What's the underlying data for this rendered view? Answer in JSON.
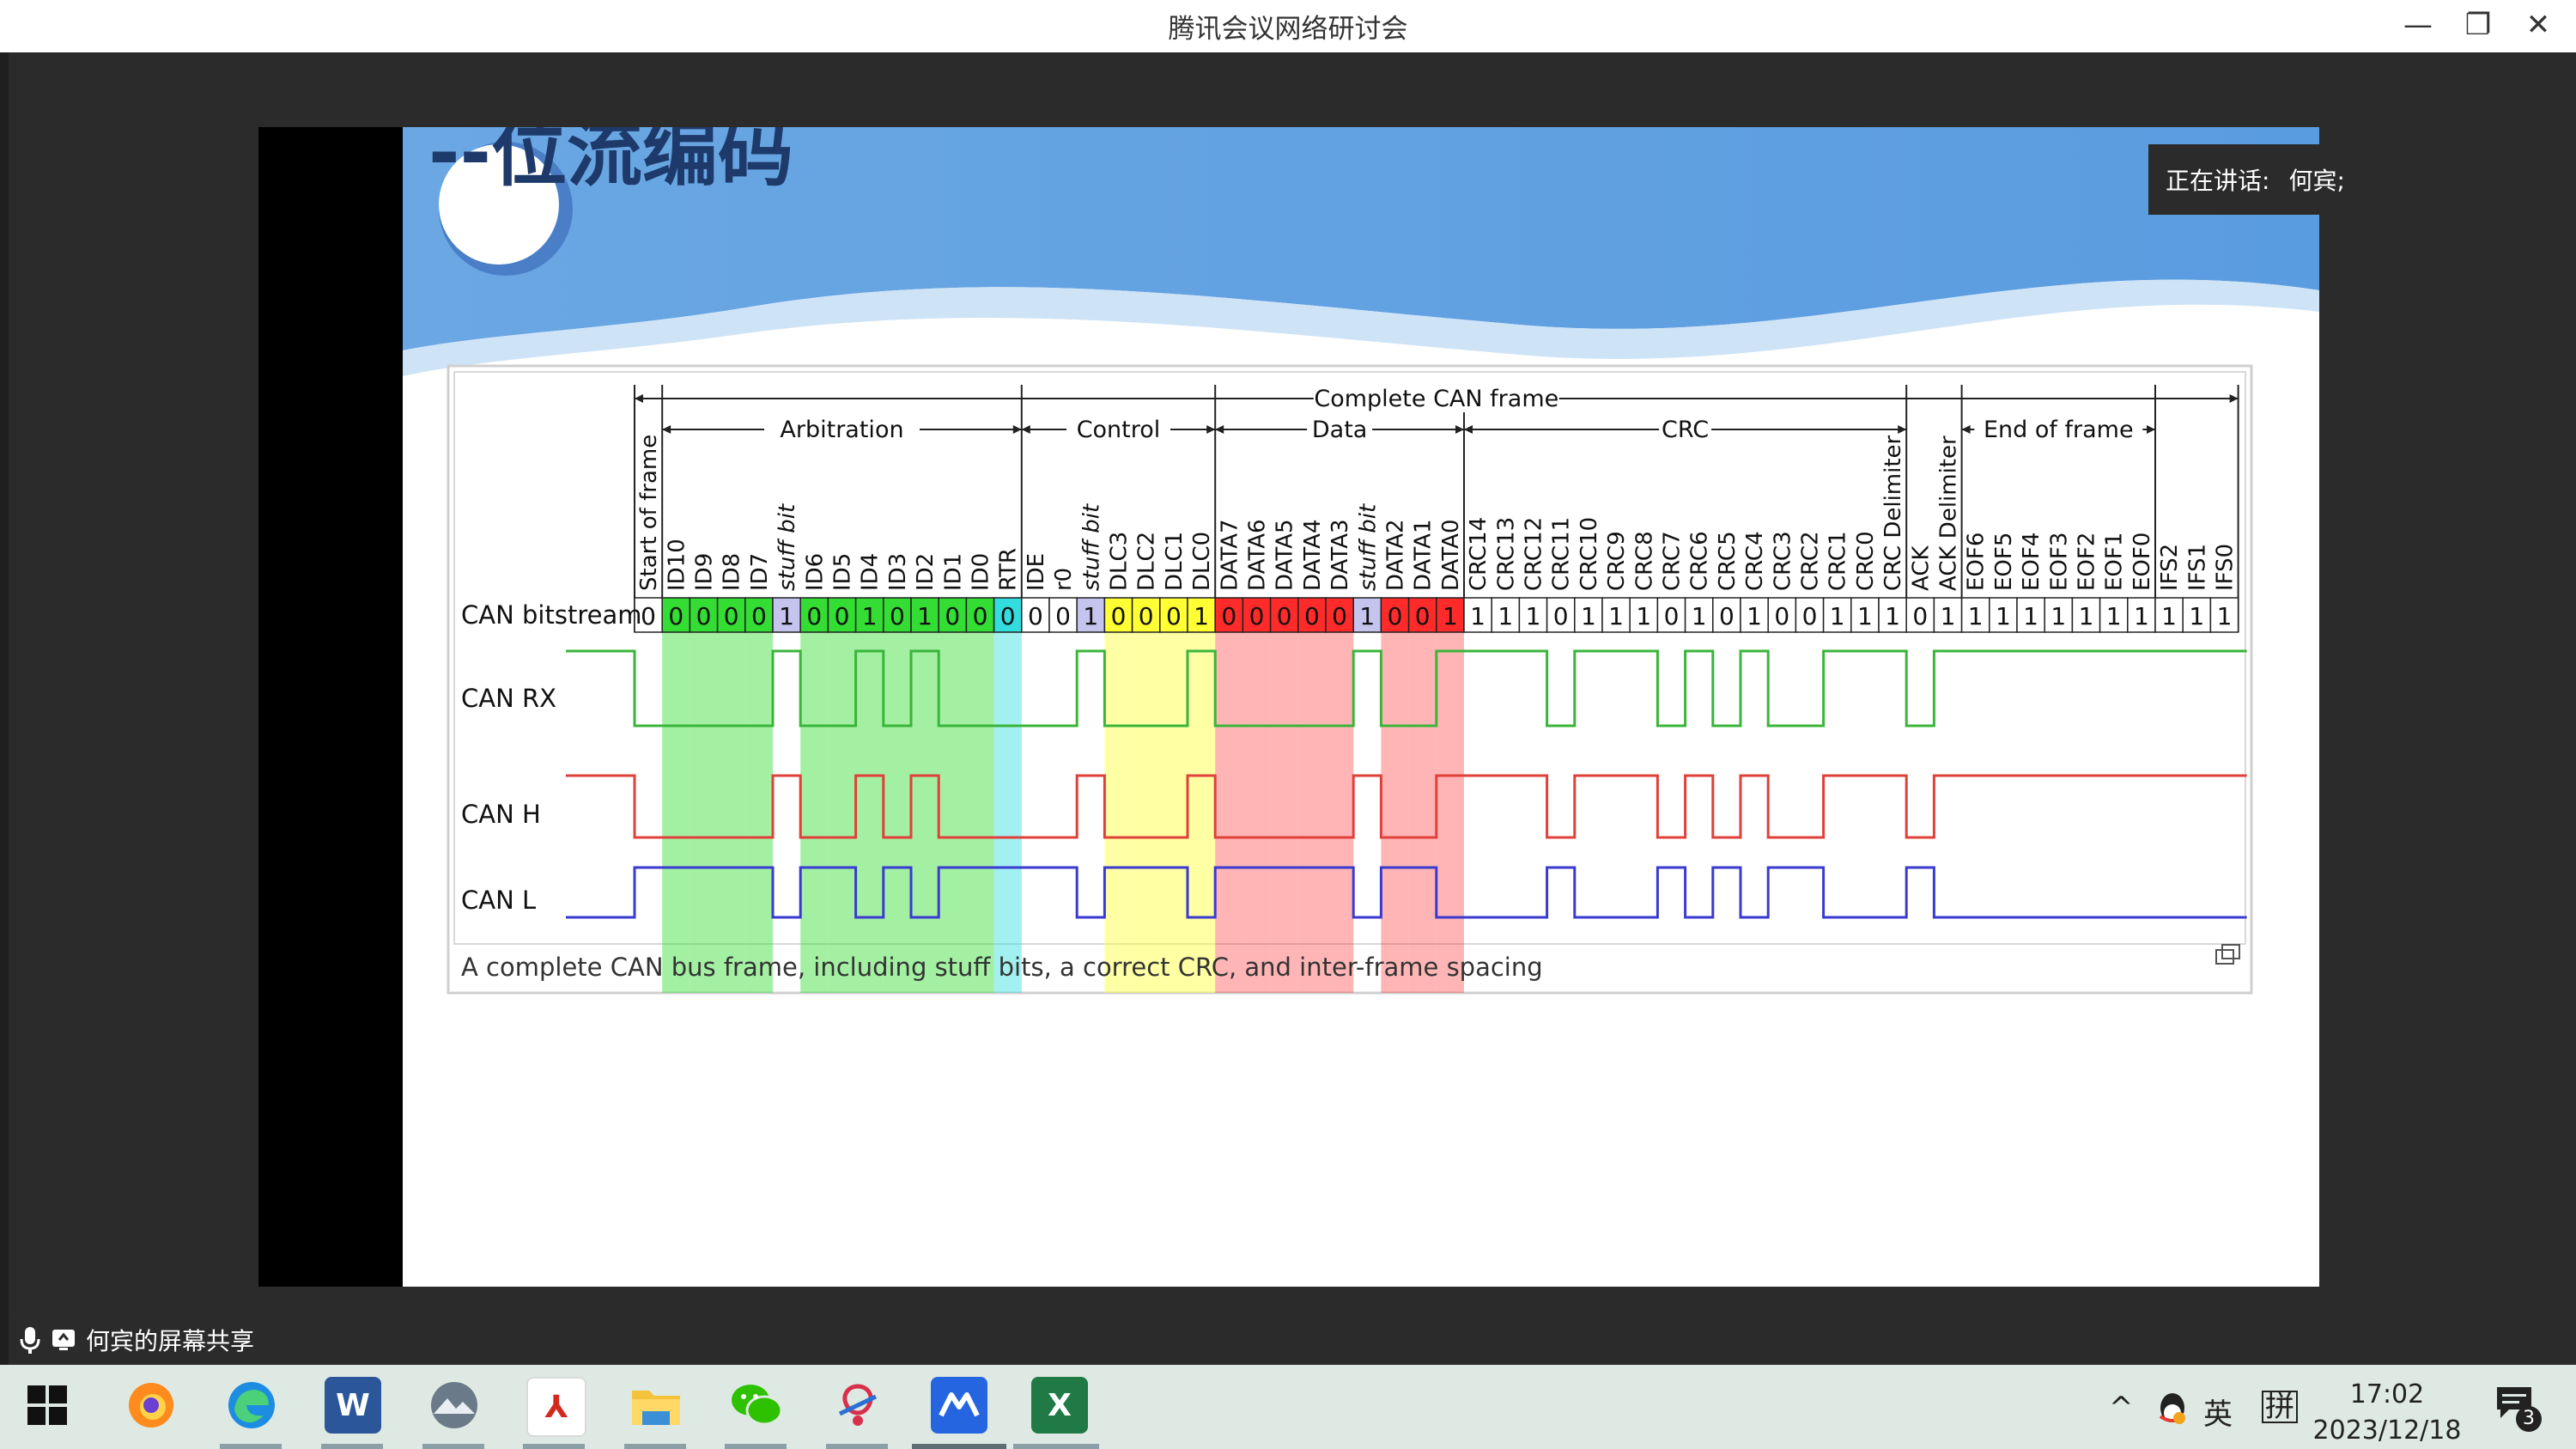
{
  "window": {
    "title": "腾讯会议网络研讨会"
  },
  "speaker": {
    "label": "正在讲话:",
    "name": "何宾;"
  },
  "share": {
    "label": "何宾的屏幕共享"
  },
  "slide": {
    "title": "--位流编码",
    "caption": "A complete CAN bus frame, including stuff bits, a correct CRC, and inter-frame spacing",
    "groups": {
      "complete": "Complete CAN frame",
      "arbitration": "Arbitration",
      "control": "Control",
      "data": "Data",
      "crc": "CRC",
      "eof": "End of frame"
    },
    "row_labels": {
      "bitstream": "CAN bitstream",
      "rx": "CAN RX",
      "h": "CAN H",
      "l": "CAN L"
    },
    "fields": [
      "Start of frame",
      "ID10",
      "ID9",
      "ID8",
      "ID7",
      "stuff bit",
      "ID6",
      "ID5",
      "ID4",
      "ID3",
      "ID2",
      "ID1",
      "ID0",
      "RTR",
      "IDE",
      "r0",
      "stuff bit",
      "DLC3",
      "DLC2",
      "DLC1",
      "DLC0",
      "DATA7",
      "DATA6",
      "DATA5",
      "DATA4",
      "DATA3",
      "stuff bit",
      "DATA2",
      "DATA1",
      "DATA0",
      "CRC14",
      "CRC13",
      "CRC12",
      "CRC11",
      "CRC10",
      "CRC9",
      "CRC8",
      "CRC7",
      "CRC6",
      "CRC5",
      "CRC4",
      "CRC3",
      "CRC2",
      "CRC1",
      "CRC0",
      "CRC Delimiter",
      "ACK",
      "ACK Delimiter",
      "EOF6",
      "EOF5",
      "EOF4",
      "EOF3",
      "EOF2",
      "EOF1",
      "EOF0",
      "IFS2",
      "IFS1",
      "IFS0"
    ],
    "bits": [
      "0",
      "0",
      "0",
      "0",
      "0",
      "1",
      "0",
      "0",
      "1",
      "0",
      "1",
      "0",
      "0",
      "0",
      "0",
      "0",
      "1",
      "0",
      "0",
      "0",
      "1",
      "0",
      "0",
      "0",
      "0",
      "0",
      "1",
      "0",
      "0",
      "1",
      "1",
      "1",
      "1",
      "0",
      "1",
      "1",
      "1",
      "0",
      "1",
      "0",
      "1",
      "0",
      "0",
      "1",
      "1",
      "1",
      "0",
      "1",
      "1",
      "1",
      "1",
      "1",
      "1",
      "1",
      "1",
      "1",
      "1",
      "1"
    ],
    "categories": [
      "sof",
      "arb",
      "arb",
      "arb",
      "arb",
      "stuff",
      "arb",
      "arb",
      "arb",
      "arb",
      "arb",
      "arb",
      "arb",
      "rtr",
      "ctrl",
      "ctrl",
      "stuff",
      "dlc",
      "dlc",
      "dlc",
      "dlc",
      "data",
      "data",
      "data",
      "data",
      "data",
      "stuff",
      "data",
      "data",
      "data",
      "crc",
      "crc",
      "crc",
      "crc",
      "crc",
      "crc",
      "crc",
      "crc",
      "crc",
      "crc",
      "crc",
      "crc",
      "crc",
      "crc",
      "crc",
      "crc",
      "crc",
      "crc",
      "crc",
      "crc",
      "crc",
      "crc",
      "crc",
      "crc",
      "crc",
      "crc",
      "crc",
      "crc"
    ]
  },
  "colors": {
    "arb": "#33dd33",
    "stuff": "#c4c4ee",
    "rtr": "#33dddd",
    "dlc": "#ffff33",
    "data": "#ff2a2a",
    "rx": "#3ab53a",
    "h": "#e0403a",
    "l": "#3a3ad0"
  },
  "taskbar": {
    "icons": [
      "windows-start-icon",
      "firefox-icon",
      "edge-icon",
      "word-icon",
      "photo-viewer-icon",
      "acrobat-icon",
      "file-explorer-icon",
      "wechat-icon",
      "xmind-icon",
      "tencent-meeting-icon",
      "excel-icon"
    ],
    "ime1": "英",
    "ime2": "拼",
    "time": "17:02",
    "date": "2023/12/18",
    "notifications": "3"
  }
}
